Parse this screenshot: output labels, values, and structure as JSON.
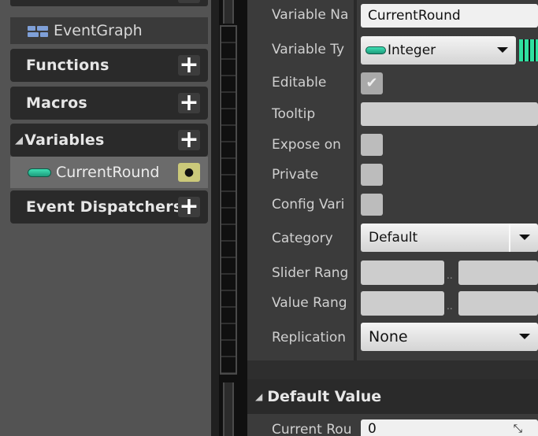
{
  "my_blueprint": {
    "event_graph_label": "EventGraph",
    "categories": {
      "functions": "Functions",
      "macros": "Macros",
      "variables": "Variables",
      "event_dispatchers": "Event Dispatchers"
    },
    "variable_item": {
      "name": "CurrentRound",
      "type_color": "#2fc79b"
    }
  },
  "details": {
    "rows": {
      "variable_name": {
        "label": "Variable Na",
        "value": "CurrentRound"
      },
      "variable_type": {
        "label": "Variable Ty",
        "value": "Integer"
      },
      "editable": {
        "label": "Editable",
        "checked": true
      },
      "tooltip": {
        "label": "Tooltip",
        "value": ""
      },
      "expose_on": {
        "label": "Expose on",
        "checked": false
      },
      "private": {
        "label": "Private",
        "checked": false
      },
      "config_variable": {
        "label": "Config Vari",
        "checked": false
      },
      "category": {
        "label": "Category",
        "value": "Default"
      },
      "slider_range": {
        "label": "Slider Rang",
        "separator": ".."
      },
      "value_range": {
        "label": "Value Rang",
        "separator": ".."
      },
      "replication": {
        "label": "Replication",
        "value": "None"
      }
    },
    "default_value_section": {
      "title": "Default Value",
      "current_round": {
        "label": "Current Rou",
        "value": "0"
      }
    }
  },
  "colors": {
    "integer_pin": "#2fc79b",
    "grid_icon": "#2fe0a0",
    "eye_button": "#cbc97a"
  }
}
